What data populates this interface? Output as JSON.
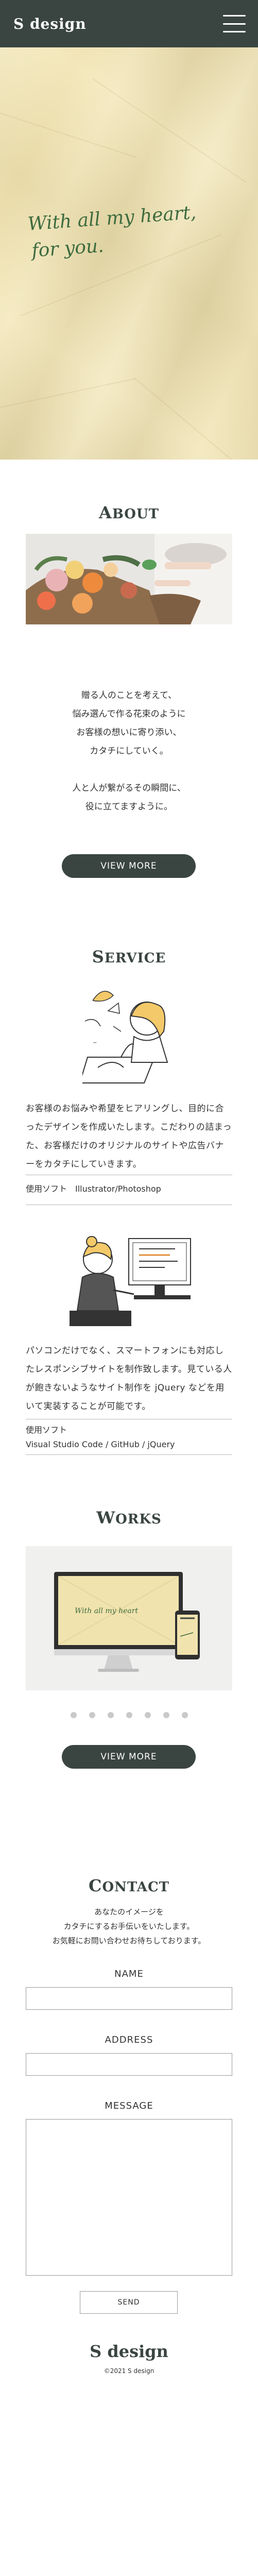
{
  "header": {
    "logo": "S design"
  },
  "hero": {
    "line1": "With all my heart,",
    "line2": "for you."
  },
  "about": {
    "title": "ABOUT",
    "lines": [
      "贈る人のことを考えて、",
      "悩み選んで作る花束のように",
      "お客様の想いに寄り添い、",
      "カタチにしていく。",
      "",
      "人と人が繋がるその瞬間に、",
      "役に立てますように。"
    ],
    "button": "VIEW MORE"
  },
  "service": {
    "title": "SERVICE",
    "text1": "お客様のお悩みや希望をヒアリングし、目的に合ったデザインを作成いたします。こだわりの詰まった、お客様だけのオリジナルのサイトや広告バナーをカタチにしていきます。",
    "software1": "使用ソフト　Illustrator/Photoshop",
    "text2": "パソコンだけでなく、スマートフォンにも対応したレスポンシブサイトを制作致します。見ている人が飽きないようなサイト制作を jQuery などを用いて実装することが可能です。",
    "software2_label": "使用ソフト",
    "software2_value": "Visual Studio Code / GitHub / jQuery"
  },
  "works": {
    "title": "WORKS",
    "screen_text": "With all my heart",
    "button": "VIEW MORE",
    "slides": 7
  },
  "contact": {
    "title": "CONTACT",
    "lines": [
      "あなたのイメージを",
      "カタチにするお手伝いをいたします。",
      "お気軽にお問い合わせお待ちしております。"
    ],
    "name_label": "NAME",
    "address_label": "ADDRESS",
    "message_label": "MESSAGE",
    "send": "SEND"
  },
  "footer": {
    "logo": "S design",
    "copyright": "©2021 S design"
  },
  "colors": {
    "primary": "#3a4541",
    "hero_bg": "#f1e3ae",
    "script_green": "#3d6b3e"
  }
}
